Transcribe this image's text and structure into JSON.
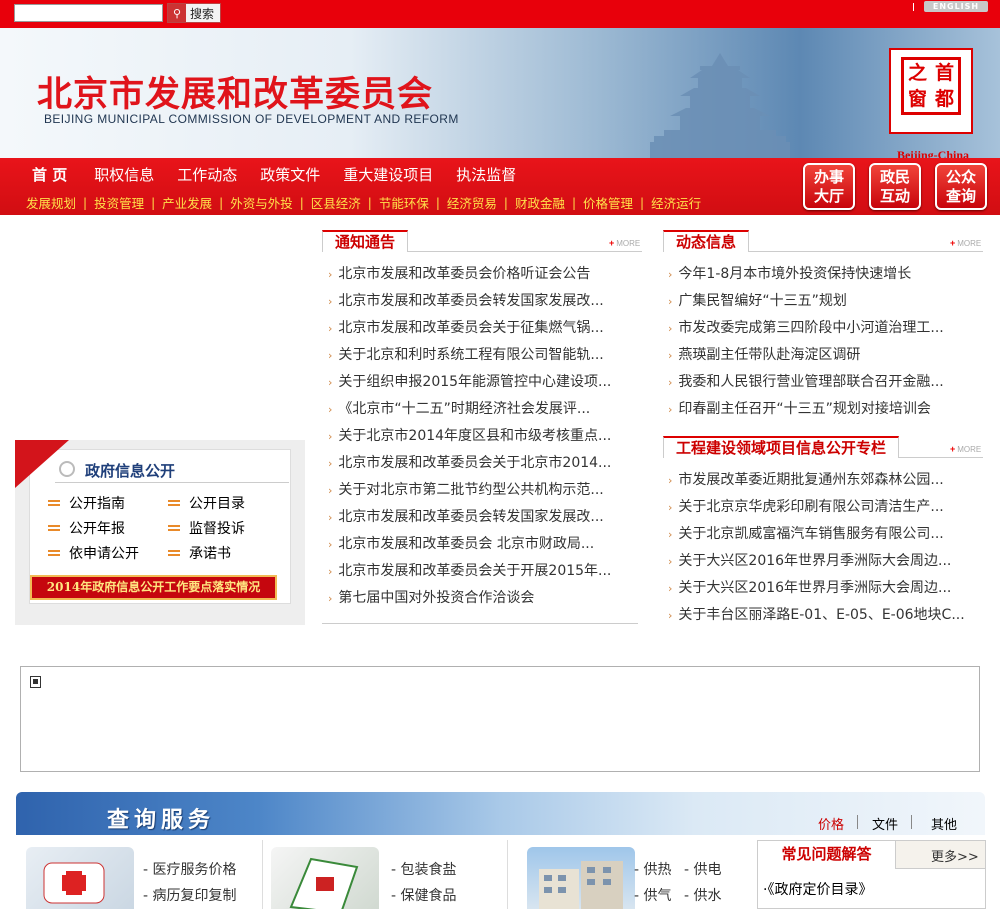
{
  "topbar": {
    "search_placeholder": "",
    "search_label": "搜索",
    "english_label": "ENGLISH"
  },
  "banner": {
    "title": "北京市发展和改革委员会",
    "subtitle": "BEIJING MUNICIPAL COMMISSION OF DEVELOPMENT AND REFORM",
    "logo_chars": [
      "之",
      "首",
      "窗",
      "都"
    ],
    "logo_text": "Beijing-China"
  },
  "nav": {
    "main": [
      "首 页",
      "职权信息",
      "工作动态",
      "政策文件",
      "重大建设项目",
      "执法监督"
    ],
    "sub": [
      "发展规划",
      "投资管理",
      "产业发展",
      "外资与外投",
      "区县经济",
      "节能环保",
      "经济贸易",
      "财政金融",
      "价格管理",
      "经济运行"
    ],
    "buttons": [
      {
        "line1": "办事",
        "line2": "大厅"
      },
      {
        "line1": "政民",
        "line2": "互动"
      },
      {
        "line1": "公众",
        "line2": "查询"
      }
    ]
  },
  "gov_info": {
    "title": "政府信息公开",
    "links": [
      "公开指南",
      "公开目录",
      "公开年报",
      "监督投诉",
      "依申请公开",
      "承诺书"
    ],
    "banner": "2014年政府信息公开工作要点落实情况"
  },
  "notices": {
    "title": "通知通告",
    "more": "MORE",
    "items": [
      "北京市发展和改革委员会价格听证会公告",
      "北京市发展和改革委员会转发国家发展改...",
      "北京市发展和改革委员会关于征集燃气锅...",
      "关于北京和利时系统工程有限公司智能轨...",
      "关于组织申报2015年能源管控中心建设项...",
      "《北京市“十二五”时期经济社会发展评...",
      "关于北京市2014年度区县和市级考核重点...",
      "北京市发展和改革委员会关于北京市2014...",
      "关于对北京市第二批节约型公共机构示范...",
      "北京市发展和改革委员会转发国家发展改...",
      "北京市发展和改革委员会 北京市财政局...",
      "北京市发展和改革委员会关于开展2015年...",
      "第七届中国对外投资合作洽谈会"
    ]
  },
  "dynamics": {
    "title": "动态信息",
    "more": "MORE",
    "items": [
      "今年1-8月本市境外投资保持快速增长",
      "广集民智编好“十三五”规划",
      "市发改委完成第三四阶段中小河道治理工...",
      "燕瑛副主任带队赴海淀区调研",
      "我委和人民银行营业管理部联合召开金融...",
      "印春副主任召开“十三五”规划对接培训会"
    ]
  },
  "projects": {
    "title": "工程建设领域项目信息公开专栏",
    "more": "MORE",
    "items": [
      "市发展改革委近期批复通州东郊森林公园...",
      "关于北京京华虎彩印刷有限公司清洁生产...",
      "关于北京凯威富福汽车销售服务有限公司...",
      "关于大兴区2016年世界月季洲际大会周边...",
      "关于大兴区2016年世界月季洲际大会周边...",
      "关于丰台区丽泽路E-01、E-05、E-06地块C..."
    ]
  },
  "query": {
    "title": "查询服务",
    "tabs": [
      "价格",
      "文件",
      "其他"
    ],
    "col1": [
      "- 医疗服务价格",
      "- 病历复印复制"
    ],
    "col2": [
      "- 包装食盐",
      "- 保健食品"
    ],
    "col3a": [
      "- 供热",
      "- 供气"
    ],
    "col3b": [
      "- 供电",
      "- 供水"
    ],
    "faq_title": "常见问题解答",
    "faq_more": "更多>>",
    "faq_items": [
      "·《政府定价目录》"
    ]
  }
}
